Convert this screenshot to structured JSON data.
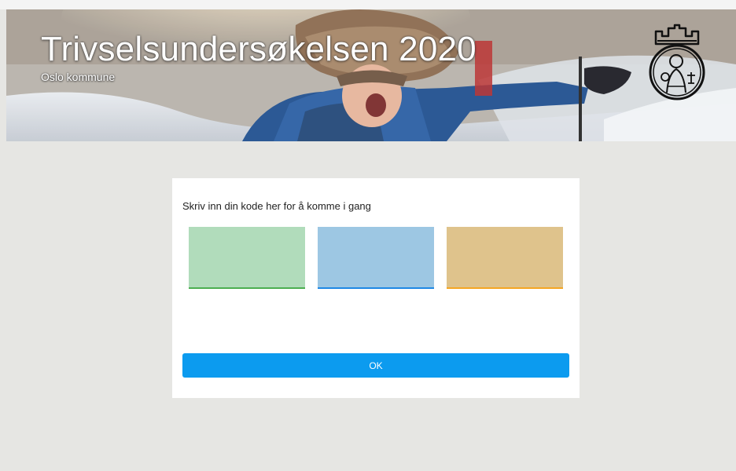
{
  "header": {
    "title": "Trivselsundersøkelsen 2020",
    "subtitle": "Oslo kommune",
    "logo_icon": "oslo-kommune-coat-of-arms-icon"
  },
  "form": {
    "prompt": "Skriv inn din kode her for å komme i gang",
    "code_fields": [
      {
        "value": "",
        "color": "#b1dcbb",
        "underline": "#4caf50"
      },
      {
        "value": "",
        "color": "#9dc7e3",
        "underline": "#1e88e5"
      },
      {
        "value": "",
        "color": "#dfc38c",
        "underline": "#f5a623"
      }
    ],
    "submit_label": "OK",
    "submit_color": "#0c9bef"
  },
  "colors": {
    "page_background": "#e6e6e3",
    "card_background": "#ffffff"
  }
}
